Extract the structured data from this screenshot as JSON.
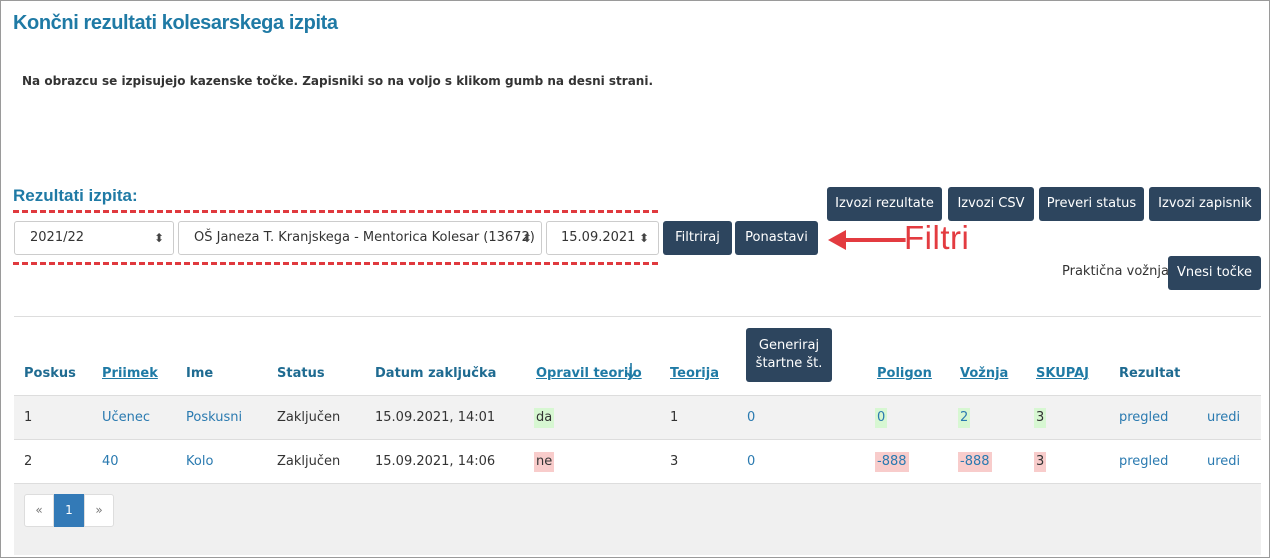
{
  "page": {
    "title": "Končni rezultati kolesarskega izpita",
    "intro": "Na obrazcu se izpisujejo kazenske točke. Zapisniki so na voljo s klikom gumb na desni strani.",
    "section_title": "Rezultati izpita:"
  },
  "filters": {
    "year": "2021/22",
    "school": "OŠ Janeza T. Kranjskega - Mentorica Kolesar (13672)",
    "date": "15.09.2021",
    "filter_label": "Filtriraj",
    "reset_label": "Ponastavi",
    "annotation": "Filtri"
  },
  "actions": {
    "export_results": "Izvozi rezultate",
    "export_csv": "Izvozi CSV",
    "check_status": "Preveri status",
    "export_record": "Izvozi zapisnik",
    "practical_label": "Praktična vožnja:",
    "enter_points": "Vnesi točke"
  },
  "table": {
    "headers": {
      "attempt": "Poskus",
      "surname": "Priimek",
      "name": "Ime",
      "status": "Status",
      "finished": "Datum zaključka",
      "passed_theory": "Opravil teorijo",
      "theory": "Teorija",
      "generate_numbers": "Generiraj štartne št.",
      "polygon": "Poligon",
      "driving": "Vožnja",
      "total": "SKUPAJ",
      "result": "Rezultat"
    },
    "sort_icon": "arrow-down-icon",
    "rows": [
      {
        "attempt": "1",
        "surname": "Učenec",
        "name": "Poskusni",
        "status": "Zaključen",
        "finished": "15.09.2021, 14:01",
        "passed_theory": "da",
        "theory": "1",
        "start_no": "0",
        "polygon": "0",
        "driving": "2",
        "total": "3",
        "view": "pregled",
        "edit": "uredi"
      },
      {
        "attempt": "2",
        "surname": "40",
        "name": "Kolo",
        "status": "Zaključen",
        "finished": "15.09.2021, 14:06",
        "passed_theory": "ne",
        "theory": "3",
        "start_no": "0",
        "polygon": "-888",
        "driving": "-888",
        "total": "3",
        "view": "pregled",
        "edit": "uredi"
      }
    ]
  },
  "pagination": {
    "prev": "«",
    "current": "1",
    "next": "»"
  },
  "colors": {
    "accent": "#1f7aa5",
    "button": "#2d455e",
    "annotation": "#e33b40",
    "pass_bg": "#d7f7d2",
    "fail_bg": "#f8cccb"
  }
}
